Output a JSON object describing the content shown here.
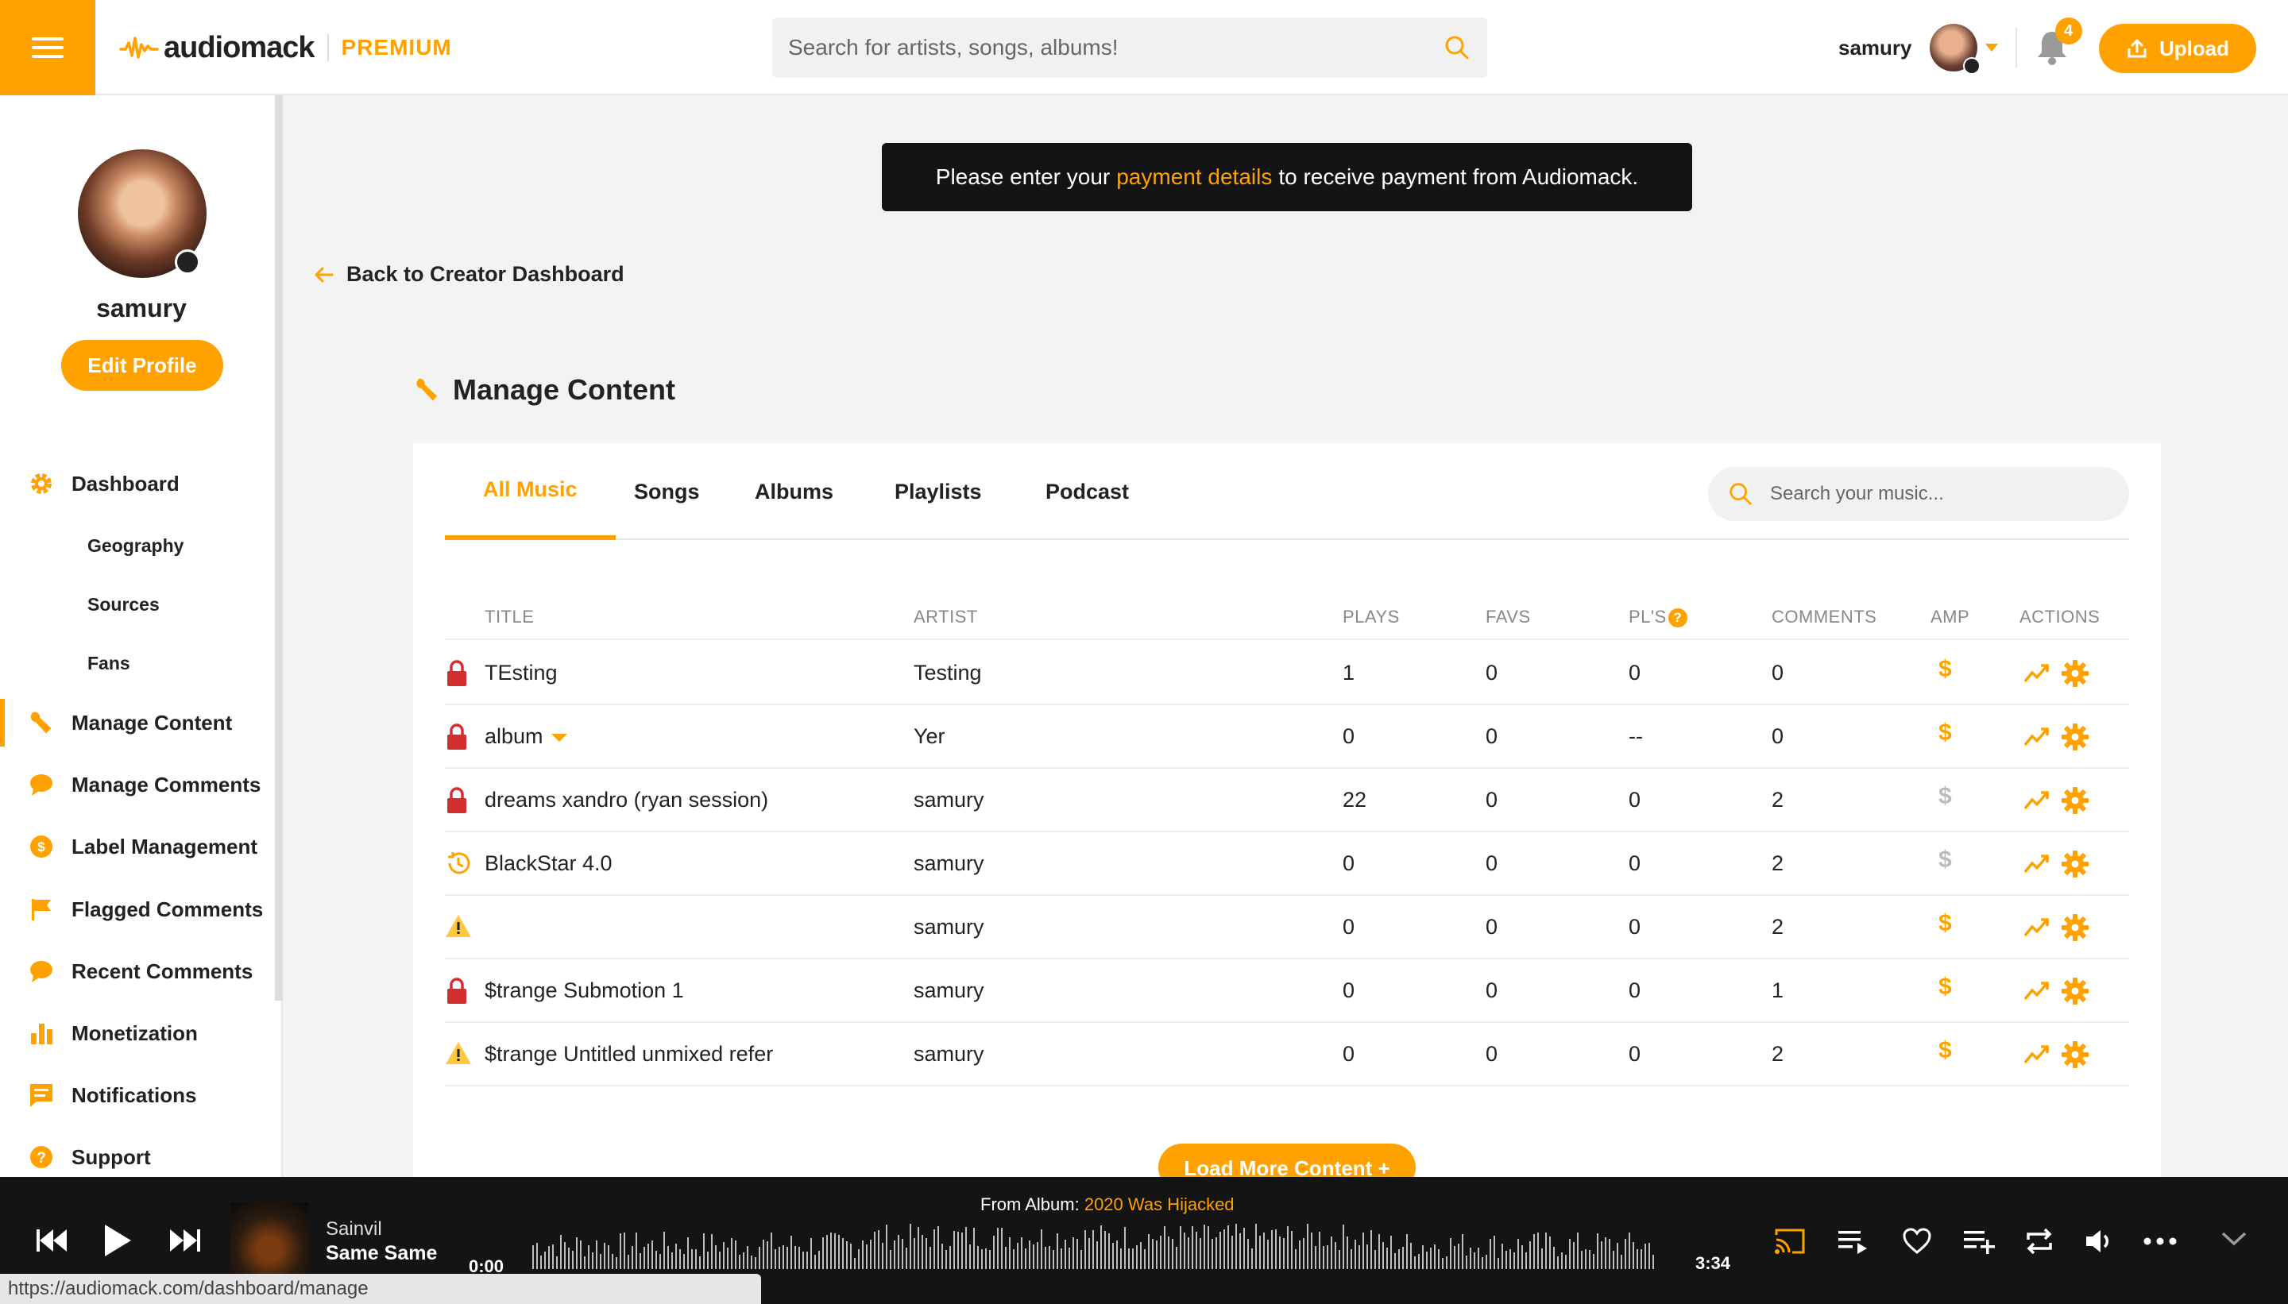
{
  "header": {
    "logo_text": "audiomack",
    "logo_badge": "PREMIUM",
    "search_placeholder": "Search for artists, songs, albums!",
    "username": "samury",
    "notification_count": "4",
    "upload_label": "Upload"
  },
  "sidebar": {
    "profile_name": "samury",
    "edit_profile_label": "Edit Profile",
    "items": [
      {
        "label": "Dashboard",
        "icon": "gear-icon"
      },
      {
        "label": "Geography"
      },
      {
        "label": "Sources"
      },
      {
        "label": "Fans"
      },
      {
        "label": "Manage Content",
        "icon": "wrench-icon",
        "active": true
      },
      {
        "label": "Manage Comments",
        "icon": "speech-bubble-icon"
      },
      {
        "label": "Label Management",
        "icon": "label-coin-icon"
      },
      {
        "label": "Flagged Comments",
        "icon": "flag-icon"
      },
      {
        "label": "Recent Comments",
        "icon": "speech-bubble-icon"
      },
      {
        "label": "Monetization",
        "icon": "bar-chart-icon"
      },
      {
        "label": "Notifications",
        "icon": "message-lines-icon"
      },
      {
        "label": "Support",
        "icon": "question-circle-icon"
      }
    ]
  },
  "banner": {
    "prefix": "Please enter your",
    "link": "payment details",
    "suffix": "to receive payment from Audiomack."
  },
  "back_link_label": "Back to Creator Dashboard",
  "page_title": "Manage Content",
  "tabs": [
    "All Music",
    "Songs",
    "Albums",
    "Playlists",
    "Podcast"
  ],
  "active_tab": "All Music",
  "music_search_placeholder": "Search your music...",
  "table": {
    "columns": [
      "TITLE",
      "ARTIST",
      "PLAYS",
      "FAVS",
      "PL'S",
      "COMMENTS",
      "AMP",
      "ACTIONS"
    ],
    "rows": [
      {
        "status": "lock",
        "title": "TEsting",
        "artist": "Testing",
        "plays": "1",
        "favs": "0",
        "pls": "0",
        "comments": "0",
        "amp": "active"
      },
      {
        "status": "lock",
        "title": "album",
        "artist": "Yer",
        "plays": "0",
        "favs": "0",
        "pls": "--",
        "comments": "0",
        "amp": "active",
        "has_dropdown": true
      },
      {
        "status": "lock",
        "title": "dreams xandro (ryan session)",
        "artist": "samury",
        "plays": "22",
        "favs": "0",
        "pls": "0",
        "comments": "2",
        "amp": "inactive"
      },
      {
        "status": "clock",
        "title": "BlackStar 4.0",
        "artist": "samury",
        "plays": "0",
        "favs": "0",
        "pls": "0",
        "comments": "2",
        "amp": "inactive"
      },
      {
        "status": "warning",
        "title": "",
        "artist": "samury",
        "plays": "0",
        "favs": "0",
        "pls": "0",
        "comments": "2",
        "amp": "active"
      },
      {
        "status": "lock",
        "title": "$trange Submotion 1",
        "artist": "samury",
        "plays": "0",
        "favs": "0",
        "pls": "0",
        "comments": "1",
        "amp": "active"
      },
      {
        "status": "warning",
        "title": "$trange Untitled unmixed refer",
        "artist": "samury",
        "plays": "0",
        "favs": "0",
        "pls": "0",
        "comments": "2",
        "amp": "active"
      }
    ]
  },
  "load_more_label": "Load More Content +",
  "player": {
    "artist": "Sainvil",
    "title": "Same Same",
    "from_album_prefix": "From Album:",
    "album": "2020 Was Hijacked",
    "elapsed": "0:00",
    "duration": "3:34"
  },
  "status_url": "https://audiomack.com/dashboard/manage",
  "colors": {
    "accent": "#ffa200",
    "lock": "#d32f2f",
    "dark": "#141414",
    "amp_inactive": "#bbbbbb"
  }
}
